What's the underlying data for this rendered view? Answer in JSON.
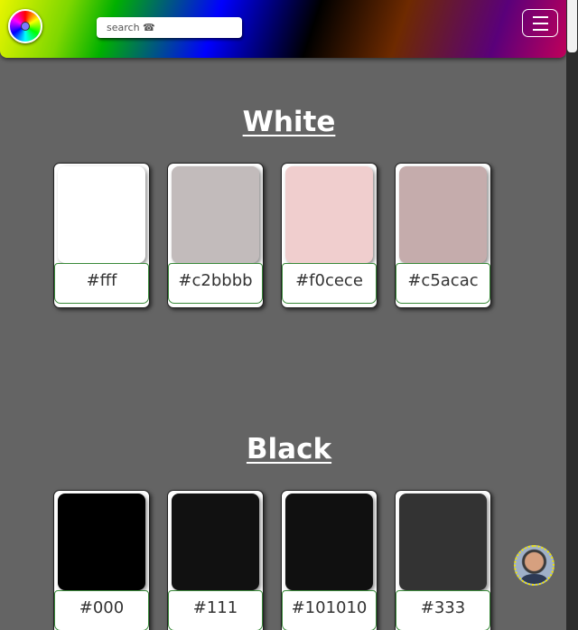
{
  "header": {
    "logo_icon": "color-wheel-icon",
    "search_placeholder": "search ☎",
    "menu_icon": "hamburger-menu-icon"
  },
  "sections": [
    {
      "title": "White",
      "colors": [
        {
          "hex": "#fff",
          "swatch": "#ffffff"
        },
        {
          "hex": "#c2bbbb",
          "swatch": "#c2bbbb"
        },
        {
          "hex": "#f0cece",
          "swatch": "#f0cece"
        },
        {
          "hex": "#c5acac",
          "swatch": "#c5acac"
        }
      ]
    },
    {
      "title": "Black",
      "colors": [
        {
          "hex": "#000",
          "swatch": "#000000"
        },
        {
          "hex": "#111",
          "swatch": "#111111"
        },
        {
          "hex": "#101010",
          "swatch": "#101010"
        },
        {
          "hex": "#333",
          "swatch": "#333333"
        }
      ]
    }
  ],
  "avatar_icon": "user-avatar-icon",
  "theme": {
    "page_bg": "#646464",
    "label_border": "#3a8a3a",
    "avatar_ring": "#f3e600"
  }
}
